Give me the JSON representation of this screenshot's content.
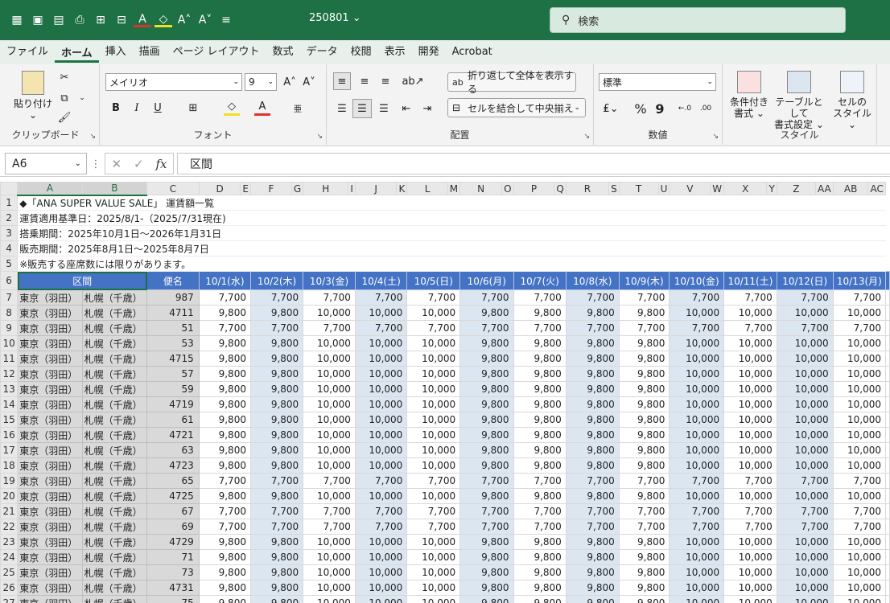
{
  "titlebar": {
    "filename": "250801",
    "search_placeholder": "検索"
  },
  "menu": [
    "ファイル",
    "ホーム",
    "挿入",
    "描画",
    "ページ レイアウト",
    "数式",
    "データ",
    "校閲",
    "表示",
    "開発",
    "Acrobat"
  ],
  "ribbon": {
    "clipboard": {
      "paste": "貼り付け",
      "label": "クリップボード"
    },
    "font": {
      "name": "メイリオ",
      "size": "9",
      "label": "フォント",
      "bold": "B",
      "italic": "I",
      "underline": "U"
    },
    "alignment": {
      "wrap": "折り返して全体を表示する",
      "merge": "セルを結合して中央揃え",
      "label": "配置"
    },
    "number": {
      "format": "標準",
      "percent": "%",
      "comma": "9",
      "label": "数値"
    },
    "styles": {
      "cond": [
        "条件付き",
        "書式"
      ],
      "table": [
        "テーブルとして",
        "書式設定"
      ],
      "cell": [
        "セルの",
        "スタイル"
      ],
      "label": "スタイル"
    }
  },
  "formula_bar": {
    "name_box": "A6",
    "fx": "fx",
    "content": "区間"
  },
  "columns": [
    "A",
    "B",
    "C",
    "D",
    "E",
    "F",
    "G",
    "H",
    "I",
    "J",
    "K",
    "L",
    "M",
    "N",
    "O",
    "P",
    "Q",
    "R",
    "S",
    "T",
    "U",
    "V",
    "W",
    "X",
    "Y",
    "Z",
    "AA",
    "AB",
    "AC"
  ],
  "info_rows": [
    {
      "row": "1",
      "text": "◆「ANA SUPER VALUE SALE」 運賃額一覧"
    },
    {
      "row": "2",
      "text": "運賃適用基準日：2025/8/1-（2025/7/31現在)"
    },
    {
      "row": "3",
      "text": "搭乗期間：2025年10月1日～2026年1月31日"
    },
    {
      "row": "4",
      "text": "販売期間：2025年8月1日～2025年8月7日"
    },
    {
      "row": "5",
      "text": "※販売する座席数には限りがあります。"
    }
  ],
  "header_row": {
    "row": "6",
    "route": "区間",
    "flight": "便名",
    "dates": [
      "10/1(水)",
      "10/2(木)",
      "10/3(金)",
      "10/4(土)",
      "10/5(日)",
      "10/6(月)",
      "10/7(火)",
      "10/8(水)",
      "10/9(木)",
      "10/10(金)",
      "10/11(土)",
      "10/12(日)",
      "10/13(月)"
    ]
  },
  "origin": "東京（羽田）",
  "destination": "札幌（千歳）",
  "fare_rows": [
    {
      "row": "7",
      "flight": "987",
      "fares": [
        "7,700",
        "7,700",
        "7,700",
        "7,700",
        "7,700",
        "7,700",
        "7,700",
        "7,700",
        "7,700",
        "7,700",
        "7,700",
        "7,700",
        "7,700"
      ]
    },
    {
      "row": "8",
      "flight": "4711",
      "fares": [
        "9,800",
        "9,800",
        "10,000",
        "10,000",
        "10,000",
        "9,800",
        "9,800",
        "9,800",
        "9,800",
        "10,000",
        "10,000",
        "10,000",
        "10,000"
      ]
    },
    {
      "row": "9",
      "flight": "51",
      "fares": [
        "7,700",
        "7,700",
        "7,700",
        "7,700",
        "7,700",
        "7,700",
        "7,700",
        "7,700",
        "7,700",
        "7,700",
        "7,700",
        "7,700",
        "7,700"
      ]
    },
    {
      "row": "10",
      "flight": "53",
      "fares": [
        "9,800",
        "9,800",
        "10,000",
        "10,000",
        "10,000",
        "9,800",
        "9,800",
        "9,800",
        "9,800",
        "10,000",
        "10,000",
        "10,000",
        "10,000"
      ]
    },
    {
      "row": "11",
      "flight": "4715",
      "fares": [
        "9,800",
        "9,800",
        "10,000",
        "10,000",
        "10,000",
        "9,800",
        "9,800",
        "9,800",
        "9,800",
        "10,000",
        "10,000",
        "10,000",
        "10,000"
      ]
    },
    {
      "row": "12",
      "flight": "57",
      "fares": [
        "9,800",
        "9,800",
        "10,000",
        "10,000",
        "10,000",
        "9,800",
        "9,800",
        "9,800",
        "9,800",
        "10,000",
        "10,000",
        "10,000",
        "10,000"
      ]
    },
    {
      "row": "13",
      "flight": "59",
      "fares": [
        "9,800",
        "9,800",
        "10,000",
        "10,000",
        "10,000",
        "9,800",
        "9,800",
        "9,800",
        "9,800",
        "10,000",
        "10,000",
        "10,000",
        "10,000"
      ]
    },
    {
      "row": "14",
      "flight": "4719",
      "fares": [
        "9,800",
        "9,800",
        "10,000",
        "10,000",
        "10,000",
        "9,800",
        "9,800",
        "9,800",
        "9,800",
        "10,000",
        "10,000",
        "10,000",
        "10,000"
      ]
    },
    {
      "row": "15",
      "flight": "61",
      "fares": [
        "9,800",
        "9,800",
        "10,000",
        "10,000",
        "10,000",
        "9,800",
        "9,800",
        "9,800",
        "9,800",
        "10,000",
        "10,000",
        "10,000",
        "10,000"
      ]
    },
    {
      "row": "16",
      "flight": "4721",
      "fares": [
        "9,800",
        "9,800",
        "10,000",
        "10,000",
        "10,000",
        "9,800",
        "9,800",
        "9,800",
        "9,800",
        "10,000",
        "10,000",
        "10,000",
        "10,000"
      ]
    },
    {
      "row": "17",
      "flight": "63",
      "fares": [
        "9,800",
        "9,800",
        "10,000",
        "10,000",
        "10,000",
        "9,800",
        "9,800",
        "9,800",
        "9,800",
        "10,000",
        "10,000",
        "10,000",
        "10,000"
      ]
    },
    {
      "row": "18",
      "flight": "4723",
      "fares": [
        "9,800",
        "9,800",
        "10,000",
        "10,000",
        "10,000",
        "9,800",
        "9,800",
        "9,800",
        "9,800",
        "10,000",
        "10,000",
        "10,000",
        "10,000"
      ]
    },
    {
      "row": "19",
      "flight": "65",
      "fares": [
        "7,700",
        "7,700",
        "7,700",
        "7,700",
        "7,700",
        "7,700",
        "7,700",
        "7,700",
        "7,700",
        "7,700",
        "7,700",
        "7,700",
        "7,700"
      ]
    },
    {
      "row": "20",
      "flight": "4725",
      "fares": [
        "9,800",
        "9,800",
        "10,000",
        "10,000",
        "10,000",
        "9,800",
        "9,800",
        "9,800",
        "9,800",
        "10,000",
        "10,000",
        "10,000",
        "10,000"
      ]
    },
    {
      "row": "21",
      "flight": "67",
      "fares": [
        "7,700",
        "7,700",
        "7,700",
        "7,700",
        "7,700",
        "7,700",
        "7,700",
        "7,700",
        "7,700",
        "7,700",
        "7,700",
        "7,700",
        "7,700"
      ]
    },
    {
      "row": "22",
      "flight": "69",
      "fares": [
        "7,700",
        "7,700",
        "7,700",
        "7,700",
        "7,700",
        "7,700",
        "7,700",
        "7,700",
        "7,700",
        "7,700",
        "7,700",
        "7,700",
        "7,700"
      ]
    },
    {
      "row": "23",
      "flight": "4729",
      "fares": [
        "9,800",
        "9,800",
        "10,000",
        "10,000",
        "10,000",
        "9,800",
        "9,800",
        "9,800",
        "9,800",
        "10,000",
        "10,000",
        "10,000",
        "10,000"
      ]
    },
    {
      "row": "24",
      "flight": "71",
      "fares": [
        "9,800",
        "9,800",
        "10,000",
        "10,000",
        "10,000",
        "9,800",
        "9,800",
        "9,800",
        "9,800",
        "10,000",
        "10,000",
        "10,000",
        "10,000"
      ]
    },
    {
      "row": "25",
      "flight": "73",
      "fares": [
        "9,800",
        "9,800",
        "10,000",
        "10,000",
        "10,000",
        "9,800",
        "9,800",
        "9,800",
        "9,800",
        "10,000",
        "10,000",
        "10,000",
        "10,000"
      ]
    },
    {
      "row": "26",
      "flight": "4731",
      "fares": [
        "9,800",
        "9,800",
        "10,000",
        "10,000",
        "10,000",
        "9,800",
        "9,800",
        "9,800",
        "9,800",
        "10,000",
        "10,000",
        "10,000",
        "10,000"
      ]
    },
    {
      "row": "27",
      "flight": "75",
      "fares": [
        "9,800",
        "9,800",
        "10,000",
        "10,000",
        "10,000",
        "9,800",
        "9,800",
        "9,800",
        "9,800",
        "10,000",
        "10,000",
        "10,000",
        "10,000"
      ]
    }
  ],
  "colors": {
    "brand": "#1e7145",
    "header_fill": "#4472c4",
    "alt_fill": "#dce6f1",
    "route_fill": "#d9d9d9"
  }
}
